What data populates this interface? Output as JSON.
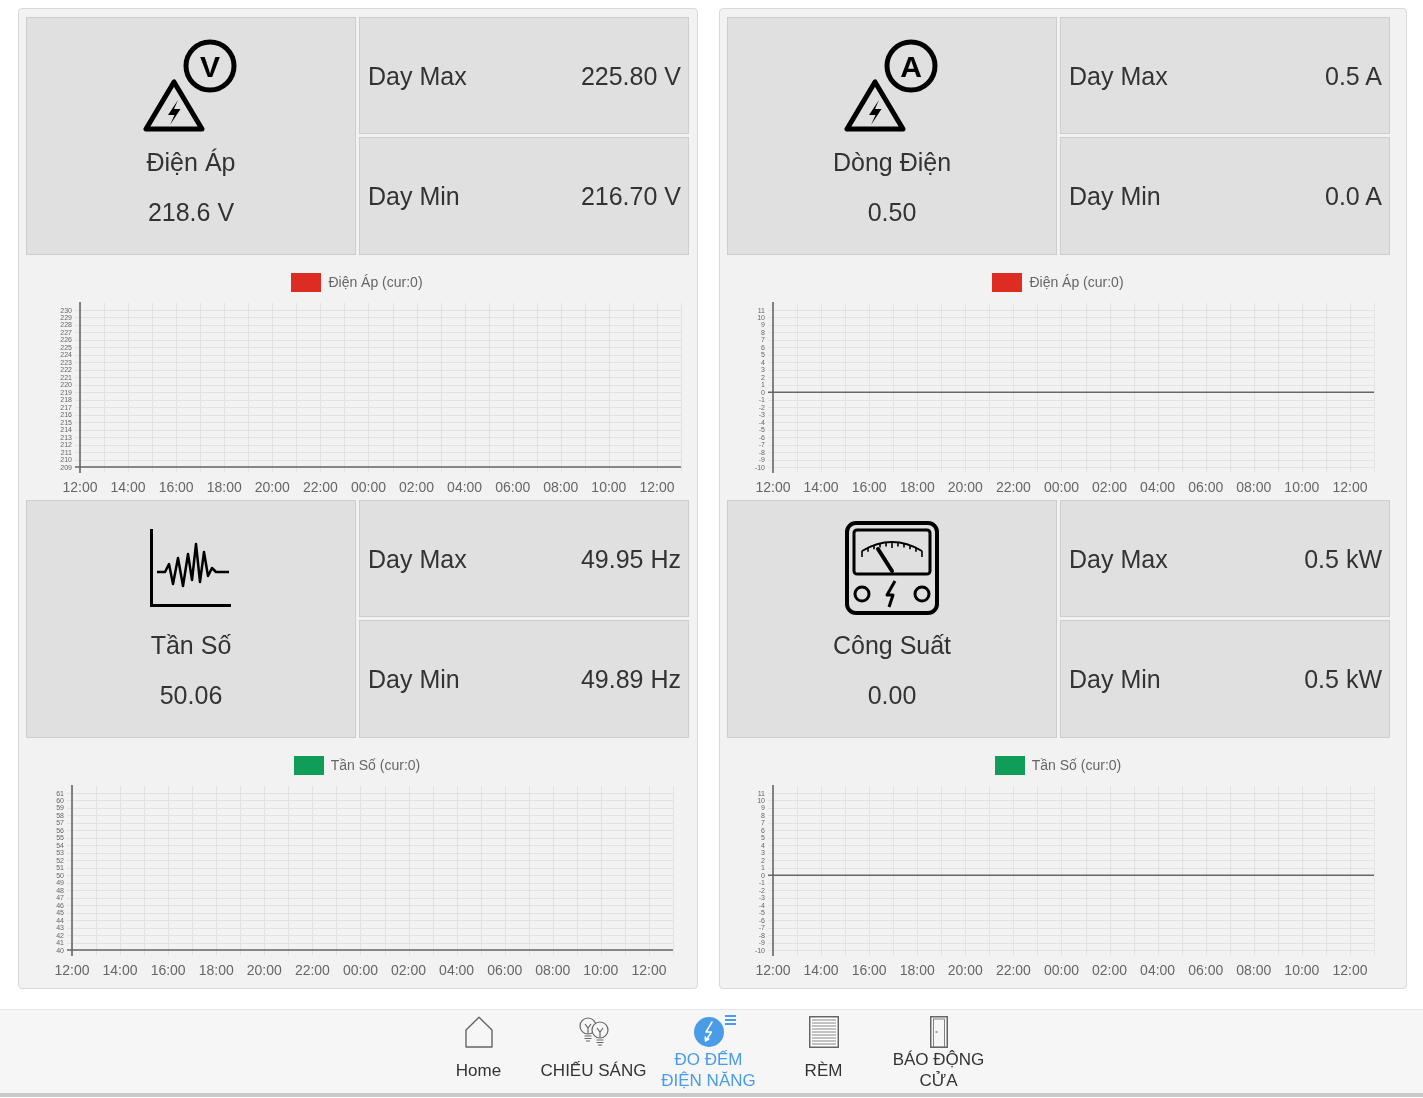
{
  "cards": [
    {
      "sections": [
        {
          "kind": "voltage",
          "icon_letter": "V",
          "name": "Điện Áp",
          "value": "218.6 V",
          "stats": [
            {
              "label": "Day Max",
              "value": "225.80 V"
            },
            {
              "label": "Day Min",
              "value": "216.70 V"
            }
          ],
          "chart_data": {
            "type": "line",
            "grid": true,
            "categories": [
              "12:00",
              "14:00",
              "16:00",
              "18:00",
              "20:00",
              "22:00",
              "00:00",
              "02:00",
              "04:00",
              "06:00",
              "08:00",
              "10:00",
              "12:00"
            ],
            "series": [
              {
                "name": "Điện Áp (cur:0)",
                "color": "#dd2c22",
                "values": [
                  null,
                  null,
                  null,
                  null,
                  null,
                  null,
                  null,
                  null,
                  null,
                  null,
                  null,
                  null,
                  null
                ]
              }
            ],
            "ylim": [
              209,
              230
            ],
            "yticks": [
              209,
              210,
              211,
              212,
              213,
              214,
              215,
              216,
              217,
              218,
              219,
              220,
              221,
              222,
              223,
              224,
              225,
              226,
              227,
              228,
              229,
              230
            ]
          }
        },
        {
          "kind": "frequency",
          "name": "Tần Số",
          "value": "50.06",
          "stats": [
            {
              "label": "Day Max",
              "value": "49.95 Hz"
            },
            {
              "label": "Day Min",
              "value": "49.89 Hz"
            }
          ],
          "chart_data": {
            "type": "line",
            "grid": true,
            "categories": [
              "12:00",
              "14:00",
              "16:00",
              "18:00",
              "20:00",
              "22:00",
              "00:00",
              "02:00",
              "04:00",
              "06:00",
              "08:00",
              "10:00",
              "12:00"
            ],
            "series": [
              {
                "name": "Tần Số (cur:0)",
                "color": "#0f9d58",
                "values": [
                  null,
                  null,
                  null,
                  null,
                  null,
                  null,
                  null,
                  null,
                  null,
                  null,
                  null,
                  null,
                  null
                ]
              }
            ],
            "ylim": [
              40,
              61
            ],
            "yticks": [
              40,
              41,
              42,
              43,
              44,
              45,
              46,
              47,
              48,
              49,
              50,
              51,
              52,
              53,
              54,
              55,
              56,
              57,
              58,
              59,
              60,
              61
            ]
          }
        }
      ]
    },
    {
      "sections": [
        {
          "kind": "current",
          "icon_letter": "A",
          "name": "Dòng Điện",
          "value": "0.50",
          "stats": [
            {
              "label": "Day Max",
              "value": "0.5 A"
            },
            {
              "label": "Day Min",
              "value": "0.0 A"
            }
          ],
          "chart_data": {
            "type": "line",
            "grid": true,
            "categories": [
              "12:00",
              "14:00",
              "16:00",
              "18:00",
              "20:00",
              "22:00",
              "00:00",
              "02:00",
              "04:00",
              "06:00",
              "08:00",
              "10:00",
              "12:00"
            ],
            "series": [
              {
                "name": "Điện Áp (cur:0)",
                "color": "#dd2c22",
                "values": [
                  null,
                  null,
                  null,
                  null,
                  null,
                  null,
                  null,
                  null,
                  null,
                  null,
                  null,
                  null,
                  null
                ]
              }
            ],
            "ylim": [
              -10,
              11
            ],
            "yticks": [
              -10,
              -9,
              -8,
              -7,
              -6,
              -5,
              -4,
              -3,
              -2,
              -1,
              0,
              1,
              2,
              3,
              4,
              5,
              6,
              7,
              8,
              9,
              10,
              11
            ]
          }
        },
        {
          "kind": "power",
          "name": "Công Suất",
          "value": "0.00",
          "stats": [
            {
              "label": "Day Max",
              "value": "0.5 kW"
            },
            {
              "label": "Day Min",
              "value": "0.5 kW"
            }
          ],
          "chart_data": {
            "type": "line",
            "grid": true,
            "categories": [
              "12:00",
              "14:00",
              "16:00",
              "18:00",
              "20:00",
              "22:00",
              "00:00",
              "02:00",
              "04:00",
              "06:00",
              "08:00",
              "10:00",
              "12:00"
            ],
            "series": [
              {
                "name": "Tần Số (cur:0)",
                "color": "#0f9d58",
                "values": [
                  null,
                  null,
                  null,
                  null,
                  null,
                  null,
                  null,
                  null,
                  null,
                  null,
                  null,
                  null,
                  null
                ]
              }
            ],
            "ylim": [
              -10,
              11
            ],
            "yticks": [
              -10,
              -9,
              -8,
              -7,
              -6,
              -5,
              -4,
              -3,
              -2,
              -1,
              0,
              1,
              2,
              3,
              4,
              5,
              6,
              7,
              8,
              9,
              10,
              11
            ]
          }
        }
      ]
    }
  ],
  "nav": [
    {
      "kind": "home",
      "label": "Home",
      "selected": false
    },
    {
      "kind": "lighting",
      "label": "CHIẾU SÁNG",
      "selected": false
    },
    {
      "kind": "energy",
      "label": "ĐO ĐẾM ĐIỆN NĂNG",
      "selected": true
    },
    {
      "kind": "curtain",
      "label": "RÈM",
      "selected": false
    },
    {
      "kind": "door-alarm",
      "label": "BÁO ĐỘNG CỬA",
      "selected": false
    }
  ]
}
